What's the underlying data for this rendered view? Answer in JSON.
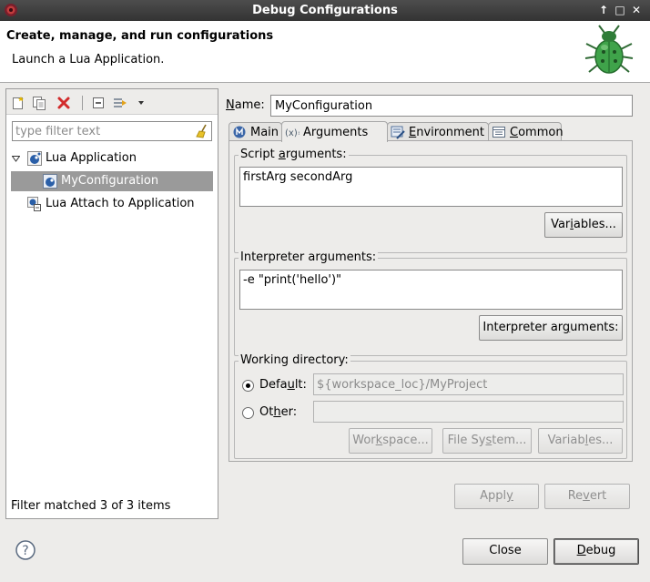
{
  "window": {
    "title": "Debug Configurations",
    "controls": [
      "↑",
      "□",
      "✕"
    ]
  },
  "header": {
    "title": "Create, manage, and run configurations",
    "subtitle": "Launch a Lua Application."
  },
  "left": {
    "toolbar_icons": [
      "new-configuration-icon",
      "duplicate-icon",
      "delete-icon",
      "collapse-all-icon",
      "filter-icon",
      "dropdown-arrow-icon"
    ],
    "filter_placeholder": "type filter text",
    "tree": [
      {
        "label": "Lua Application",
        "expanded": true,
        "children": [
          {
            "label": "MyConfiguration",
            "selected": true
          }
        ]
      },
      {
        "label": "Lua Attach to Application"
      }
    ],
    "status": "Filter matched 3 of 3 items"
  },
  "name": {
    "label_pre": "",
    "label_u": "N",
    "label_post": "ame:",
    "value": "MyConfiguration"
  },
  "tabs": [
    {
      "icon": "main-tab-icon",
      "pre": "Main",
      "u": "",
      "post": "",
      "active": false
    },
    {
      "icon": "arguments-tab-icon",
      "pre": "Arguments",
      "u": "",
      "post": "",
      "active": true
    },
    {
      "icon": "environment-tab-icon",
      "pre": "",
      "u": "E",
      "post": "nvironment",
      "active": false
    },
    {
      "icon": "common-tab-icon",
      "pre": "",
      "u": "C",
      "post": "ommon",
      "active": false
    }
  ],
  "script_args": {
    "title_pre": "Script ",
    "title_u": "a",
    "title_post": "rguments:",
    "value": "firstArg secondArg",
    "variables_pre": "Var",
    "variables_u": "i",
    "variables_post": "ables..."
  },
  "interp_args": {
    "title": "Interpreter arguments:",
    "value": "-e \"print('hello')\"",
    "button_pre": "Interpreter ar",
    "button_u": "g",
    "button_post": "uments:"
  },
  "working_dir": {
    "title": "Working directory:",
    "default_pre": "Defa",
    "default_u": "u",
    "default_post": "lt:",
    "default_value": "${workspace_loc}/MyProject",
    "other_pre": "Ot",
    "other_u": "h",
    "other_post": "er:",
    "other_value": "",
    "workspace_pre": "Wor",
    "workspace_u": "k",
    "workspace_post": "space...",
    "filesystem_pre": "File Sy",
    "filesystem_u": "s",
    "filesystem_post": "tem...",
    "variables_pre": "Variab",
    "variables_u": "l",
    "variables_post": "es..."
  },
  "actions": {
    "apply_pre": "Appl",
    "apply_u": "y",
    "apply_post": "",
    "revert_pre": "Re",
    "revert_u": "v",
    "revert_post": "ert",
    "close": "Close",
    "debug_pre": "",
    "debug_u": "D",
    "debug_post": "ebug"
  },
  "colors": {
    "titlebar": "#3d3d3d",
    "selection": "#9a9a9a",
    "delete_red": "#d22b2b",
    "lua_blue": "#2a5fa8",
    "bug_green": "#3fa34a"
  }
}
